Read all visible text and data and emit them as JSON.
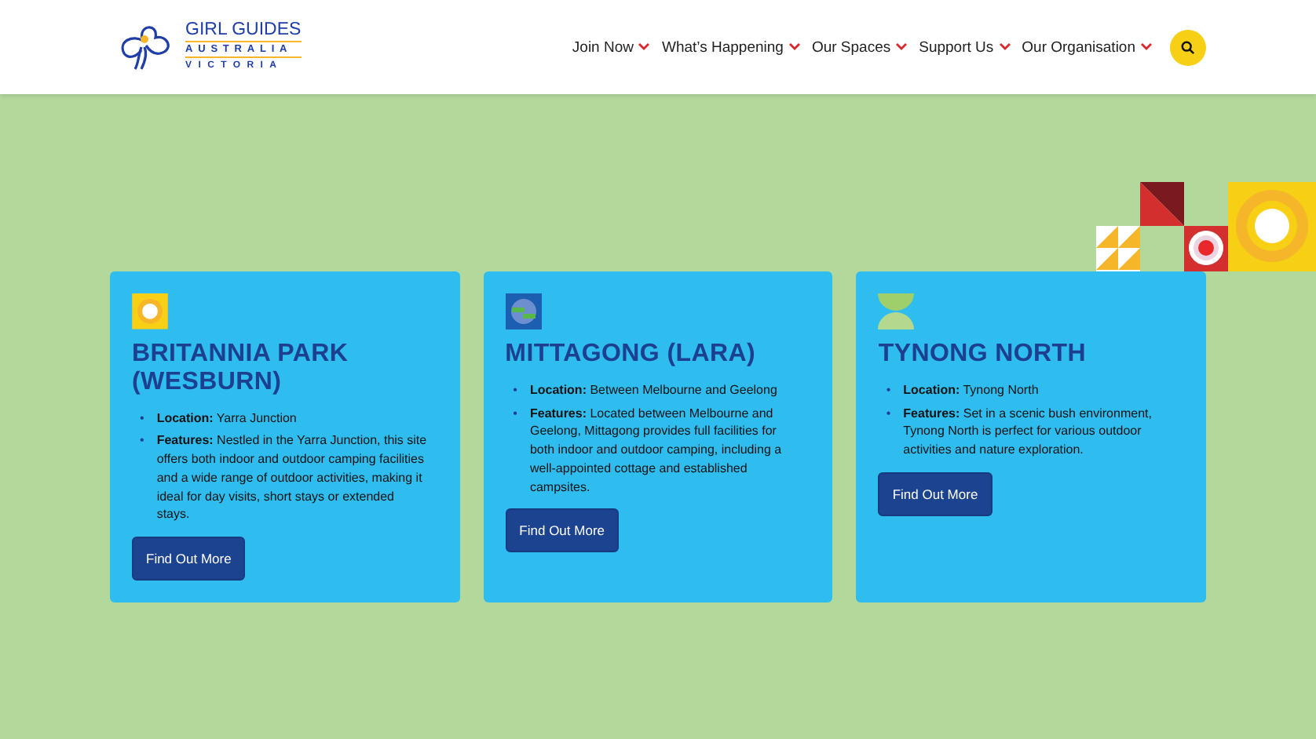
{
  "logo": {
    "lines": [
      "GIRL GUIDES",
      "AUSTRALIA",
      "VICTORIA"
    ]
  },
  "nav": [
    {
      "label": "Join Now"
    },
    {
      "label": "What’s Happening"
    },
    {
      "label": "Our Spaces"
    },
    {
      "label": "Support Us"
    },
    {
      "label": "Our Organisation"
    }
  ],
  "cards": [
    {
      "kind": "sun",
      "title": "BRITANNIA PARK (WESBURN)",
      "details": [
        {
          "bullet": "•",
          "text": "**Location:** Yarra Junction"
        },
        {
          "bullet": "•",
          "text": "**Features:** Nestled in the Yarra Junction, this site offers both indoor and outdoor camping facilities and a wide range of outdoor activities, making it ideal for day visits, short stays or extended stays."
        }
      ],
      "button": "Find Out More"
    },
    {
      "kind": "globe",
      "title": "MITTAGONG (LARA)",
      "details": [
        {
          "bullet": "•",
          "text": "**Location:** Between Melbourne and Geelong"
        },
        {
          "bullet": "•",
          "text": "**Features:** Located between Melbourne and Geelong, Mittagong provides full facilities for both indoor and outdoor camping, including a well-appointed cottage and established campsites."
        }
      ],
      "button": "Find Out More"
    },
    {
      "kind": "leaf",
      "title": "TYNONG NORTH",
      "details": [
        {
          "bullet": "•",
          "text": "**Location:** Tynong North"
        },
        {
          "bullet": "•",
          "text": "**Features:** Set in a scenic bush environment, Tynong North is perfect for various outdoor activities and nature exploration."
        }
      ],
      "button": "Find Out More"
    }
  ]
}
